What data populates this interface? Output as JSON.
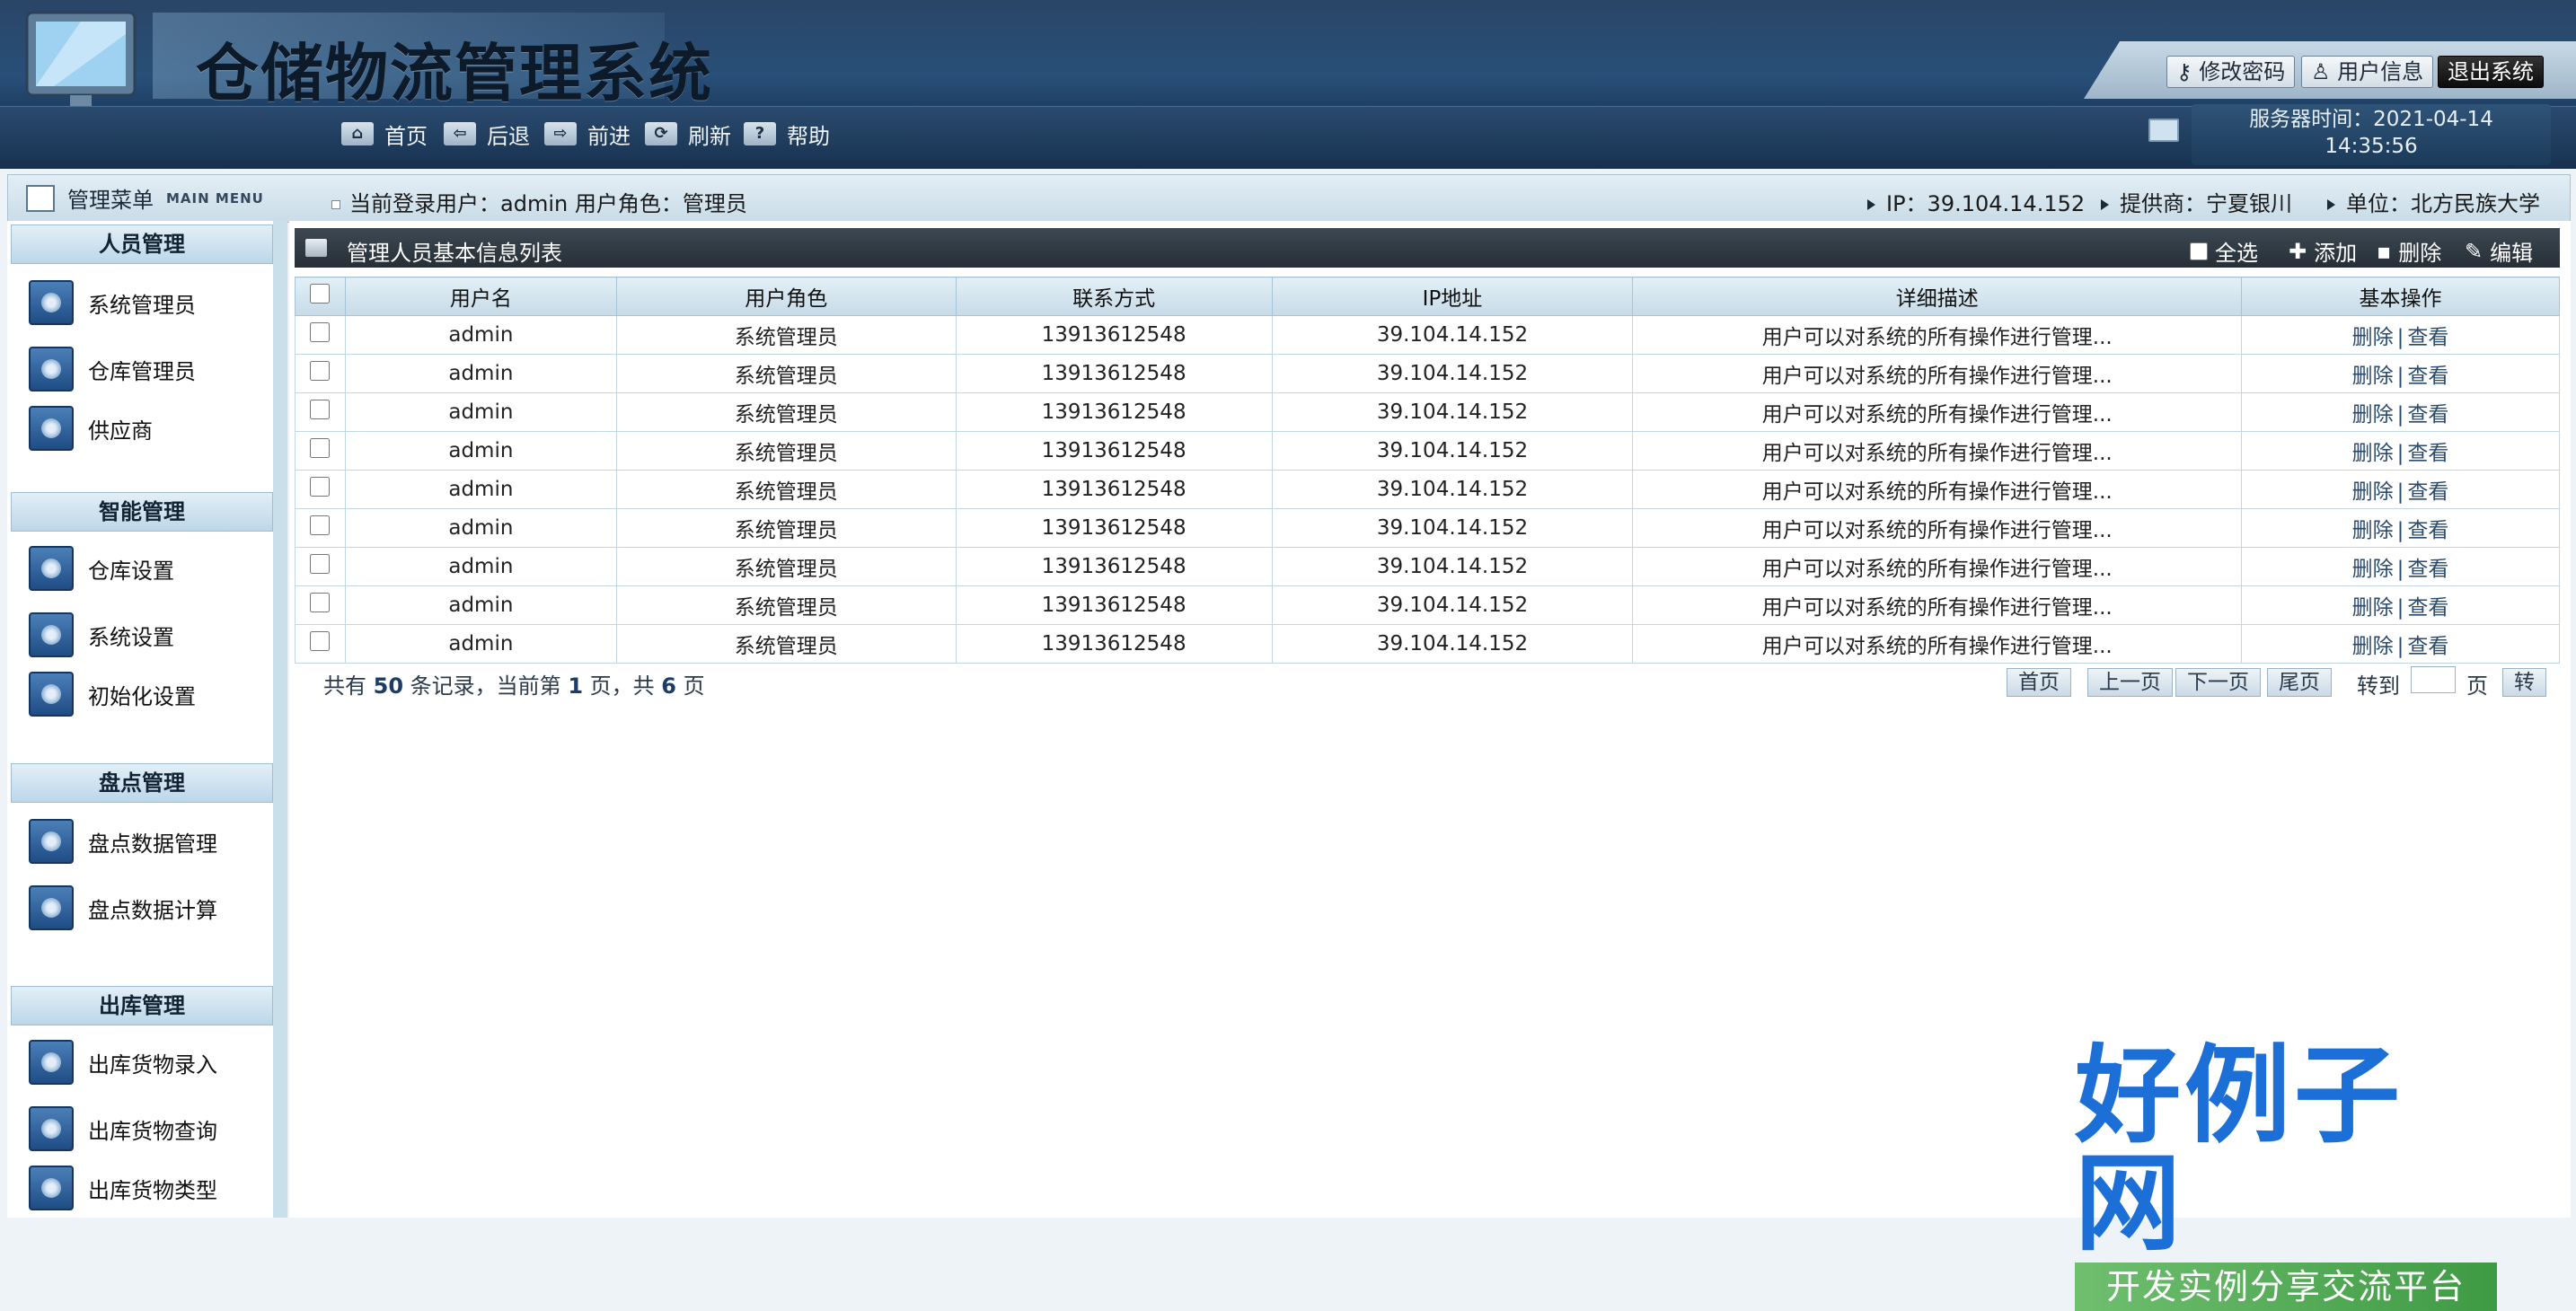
{
  "header": {
    "title": "仓储物流管理系统",
    "top_buttons": {
      "change_password": "修改密码",
      "user_info": "用户信息",
      "logout": "退出系统"
    },
    "nav": {
      "home": "首页",
      "back": "后退",
      "forward": "前进",
      "refresh": "刷新",
      "help": "帮助"
    },
    "server_time_label": "服务器时间：2021-04-14",
    "server_time_value": "14:35:56"
  },
  "infobar": {
    "menu_title": "管理菜单",
    "menu_subtitle": "MAIN MENU",
    "login_user": "当前登录用户：admin  用户角色：管理员",
    "ip": "IP：39.104.14.152",
    "provider": "提供商：宁夏银川",
    "unit": "单位：北方民族大学"
  },
  "sidebar": {
    "sections": [
      {
        "title": "人员管理",
        "items": [
          "系统管理员",
          "仓库管理员",
          "供应商"
        ]
      },
      {
        "title": "智能管理",
        "items": [
          "仓库设置",
          "系统设置",
          "初始化设置"
        ]
      },
      {
        "title": "盘点管理",
        "items": [
          "盘点数据管理",
          "盘点数据计算"
        ]
      },
      {
        "title": "出库管理",
        "items": [
          "出库货物录入",
          "出库货物查询",
          "出库货物类型"
        ]
      }
    ]
  },
  "panel": {
    "title": "管理人员基本信息列表",
    "actions": {
      "select_all": "全选",
      "add": "添加",
      "delete": "删除",
      "edit": "编辑"
    }
  },
  "table": {
    "columns": [
      "用户名",
      "用户角色",
      "联系方式",
      "IP地址",
      "详细描述",
      "基本操作"
    ],
    "rows": [
      [
        "admin",
        "系统管理员",
        "13913612548",
        "39.104.14.152",
        "用户可以对系统的所有操作进行管理..."
      ],
      [
        "admin",
        "系统管理员",
        "13913612548",
        "39.104.14.152",
        "用户可以对系统的所有操作进行管理..."
      ],
      [
        "admin",
        "系统管理员",
        "13913612548",
        "39.104.14.152",
        "用户可以对系统的所有操作进行管理..."
      ],
      [
        "admin",
        "系统管理员",
        "13913612548",
        "39.104.14.152",
        "用户可以对系统的所有操作进行管理..."
      ],
      [
        "admin",
        "系统管理员",
        "13913612548",
        "39.104.14.152",
        "用户可以对系统的所有操作进行管理..."
      ],
      [
        "admin",
        "系统管理员",
        "13913612548",
        "39.104.14.152",
        "用户可以对系统的所有操作进行管理..."
      ],
      [
        "admin",
        "系统管理员",
        "13913612548",
        "39.104.14.152",
        "用户可以对系统的所有操作进行管理..."
      ],
      [
        "admin",
        "系统管理员",
        "13913612548",
        "39.104.14.152",
        "用户可以对系统的所有操作进行管理..."
      ],
      [
        "admin",
        "系统管理员",
        "13913612548",
        "39.104.14.152",
        "用户可以对系统的所有操作进行管理..."
      ]
    ],
    "row_actions": {
      "delete": "删除",
      "view": "查看"
    }
  },
  "pager": {
    "summary_prefix": "共有 ",
    "total": "50",
    "summary_mid1": " 条记录，当前第 ",
    "current": "1",
    "summary_mid2": " 页，共 ",
    "pages": "6",
    "summary_suffix": " 页",
    "first": "首页",
    "prev": "上一页",
    "next": "下一页",
    "last": "尾页",
    "goto": "转到",
    "page_unit": "页",
    "go": "转"
  },
  "watermark": {
    "brand": "好例子网",
    "slogan": "开发实例分享交流平台"
  },
  "colors": {
    "header_bg": "#1c3a5e",
    "panel_head": "#2f3942",
    "link": "#2a4a6e",
    "brand_blue": "#1b6fd6",
    "brand_green": "#4aa84f"
  },
  "icons": [
    "monitor-logo",
    "home-icon",
    "back-icon",
    "forward-icon",
    "refresh-icon",
    "help-icon",
    "server-icon",
    "key-icon",
    "user-icon",
    "menu-icon",
    "list-icon",
    "add-icon",
    "delete-icon",
    "edit-icon"
  ]
}
